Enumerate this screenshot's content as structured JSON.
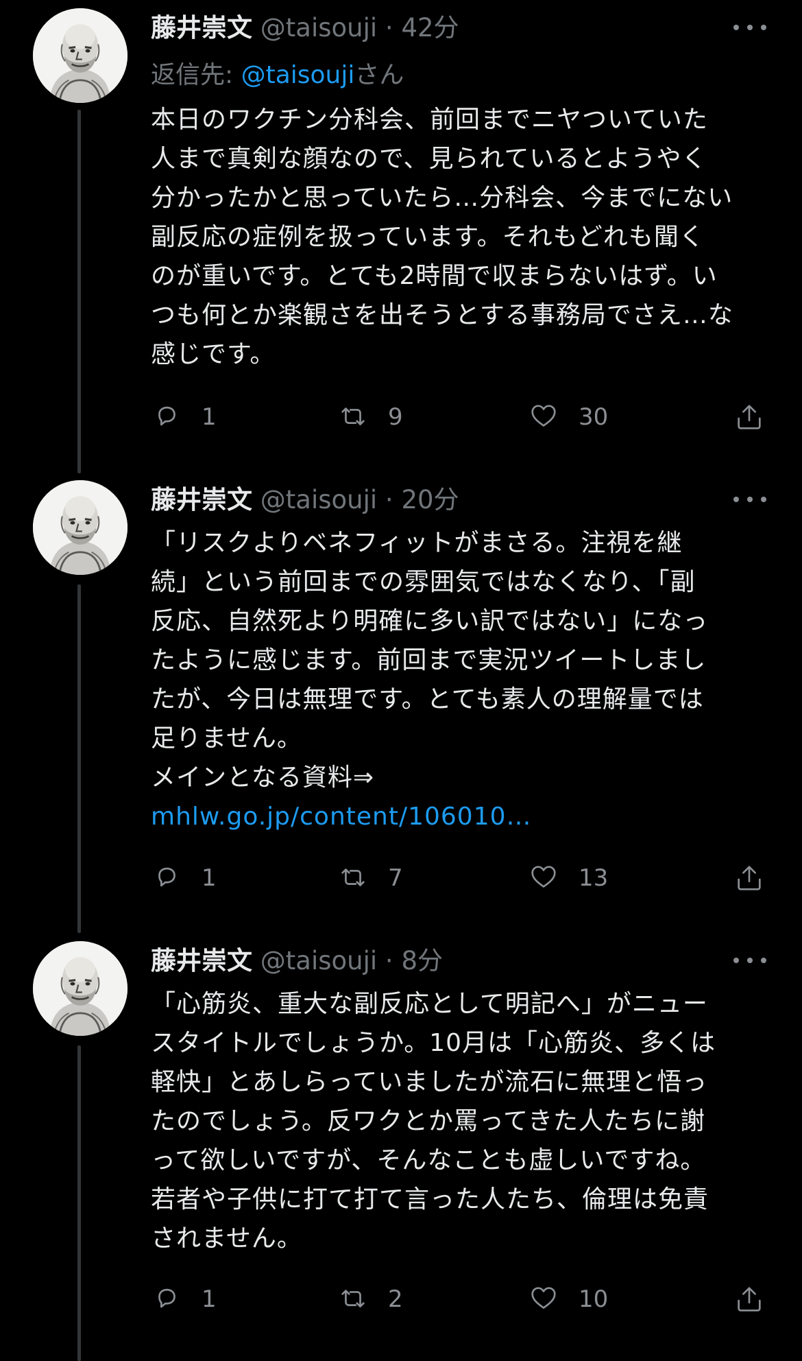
{
  "tweets": [
    {
      "name": "藤井崇文",
      "handle": "@taisouji",
      "time": "42分",
      "reply": {
        "prefix": "返信先: ",
        "mention": "@taisouji",
        "suffix": "さん"
      },
      "lines": [
        "本日のワクチン分科会、前回までニヤついていた",
        "人まで真剣な顔なので、見られているとようやく",
        "分かったかと思っていたら…分科会、今までにない",
        "副反応の症例を扱っています。それもどれも聞く",
        "のが重いです。とても2時間で収まらないはず。い",
        "つも何とか楽観さを出そうとする事務局でさえ…な",
        "感じです。"
      ],
      "link": "",
      "replies": "1",
      "retweets": "9",
      "likes": "30"
    },
    {
      "name": "藤井崇文",
      "handle": "@taisouji",
      "time": "20分",
      "lines": [
        "「リスクよりベネフィットがまさる。注視を継",
        "続」という前回までの雰囲気ではなくなり、「副",
        "反応、自然死より明確に多い訳ではない」になっ",
        "たように感じます。前回まで実況ツイートしまし",
        "たが、今日は無理です。とても素人の理解量では",
        "足りません。",
        "メインとなる資料⇒"
      ],
      "link": "mhlw.go.jp/content/106010…",
      "replies": "1",
      "retweets": "7",
      "likes": "13"
    },
    {
      "name": "藤井崇文",
      "handle": "@taisouji",
      "time": "8分",
      "lines": [
        "「心筋炎、重大な副反応として明記へ」がニュー",
        "スタイトルでしょうか。10月は「心筋炎、多くは",
        "軽快」とあしらっていましたが流石に無理と悟っ",
        "たのでしょう。反ワクとか罵ってきた人たちに謝",
        "って欲しいですが、そんなことも虚しいですね。",
        "若者や子供に打て打て言った人たち、倫理は免責",
        "されません。"
      ],
      "link": "",
      "replies": "1",
      "retweets": "2",
      "likes": "10"
    }
  ],
  "icons": [
    "avatar",
    "more-icon",
    "reply-icon",
    "retweet-icon",
    "like-icon",
    "share-icon"
  ],
  "colors": {
    "background": "#000000",
    "text": "#e7e9ea",
    "meta": "#71767b",
    "link": "#1d9bf0"
  }
}
